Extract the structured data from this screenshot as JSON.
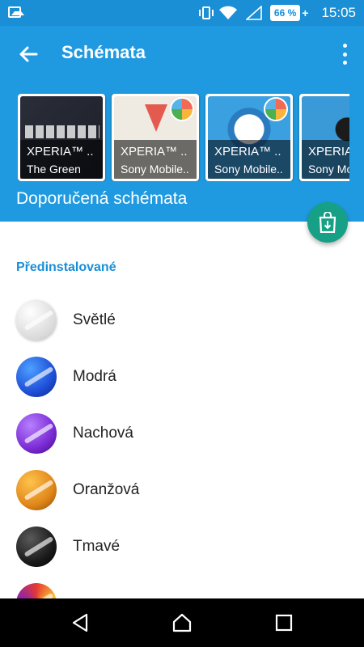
{
  "status_bar": {
    "battery": "66 %",
    "time": "15:05",
    "icons": [
      "image-icon",
      "vibrate-icon",
      "wifi-icon",
      "signal-icon",
      "battery-icon"
    ]
  },
  "app_bar": {
    "title": "Schémata",
    "icons": [
      "back-arrow-icon",
      "more-vertical-icon"
    ]
  },
  "featured": {
    "label": "Doporučená schémata",
    "cards": [
      {
        "title": "XPERIA™ ..",
        "subtitle": "The Green"
      },
      {
        "title": "XPERIA™ ..",
        "subtitle": "Sony Mobile.."
      },
      {
        "title": "XPERIA™ ..",
        "subtitle": "Sony Mobile.."
      },
      {
        "title": "XPERIA",
        "subtitle": "Sony Mo"
      }
    ]
  },
  "fab_icon": "store-download-icon",
  "preinstalled": {
    "header": "Předinstalované",
    "items": [
      {
        "name": "Světlé",
        "color": "#e8e8e8"
      },
      {
        "name": "Modrá",
        "color": "#1e4fd8"
      },
      {
        "name": "Nachová",
        "color": "#7b2bd6"
      },
      {
        "name": "Oranžová",
        "color": "#e0871a"
      },
      {
        "name": "Tmavé",
        "color": "#1b1b1b"
      }
    ]
  },
  "nav_bar": {
    "icons": [
      "back-icon",
      "home-icon",
      "recents-icon"
    ]
  },
  "colors": {
    "app_bar": "#1f9ae0",
    "status_bar": "#1a8fd6",
    "accent": "#1a8fd6",
    "fab": "#16a085"
  }
}
